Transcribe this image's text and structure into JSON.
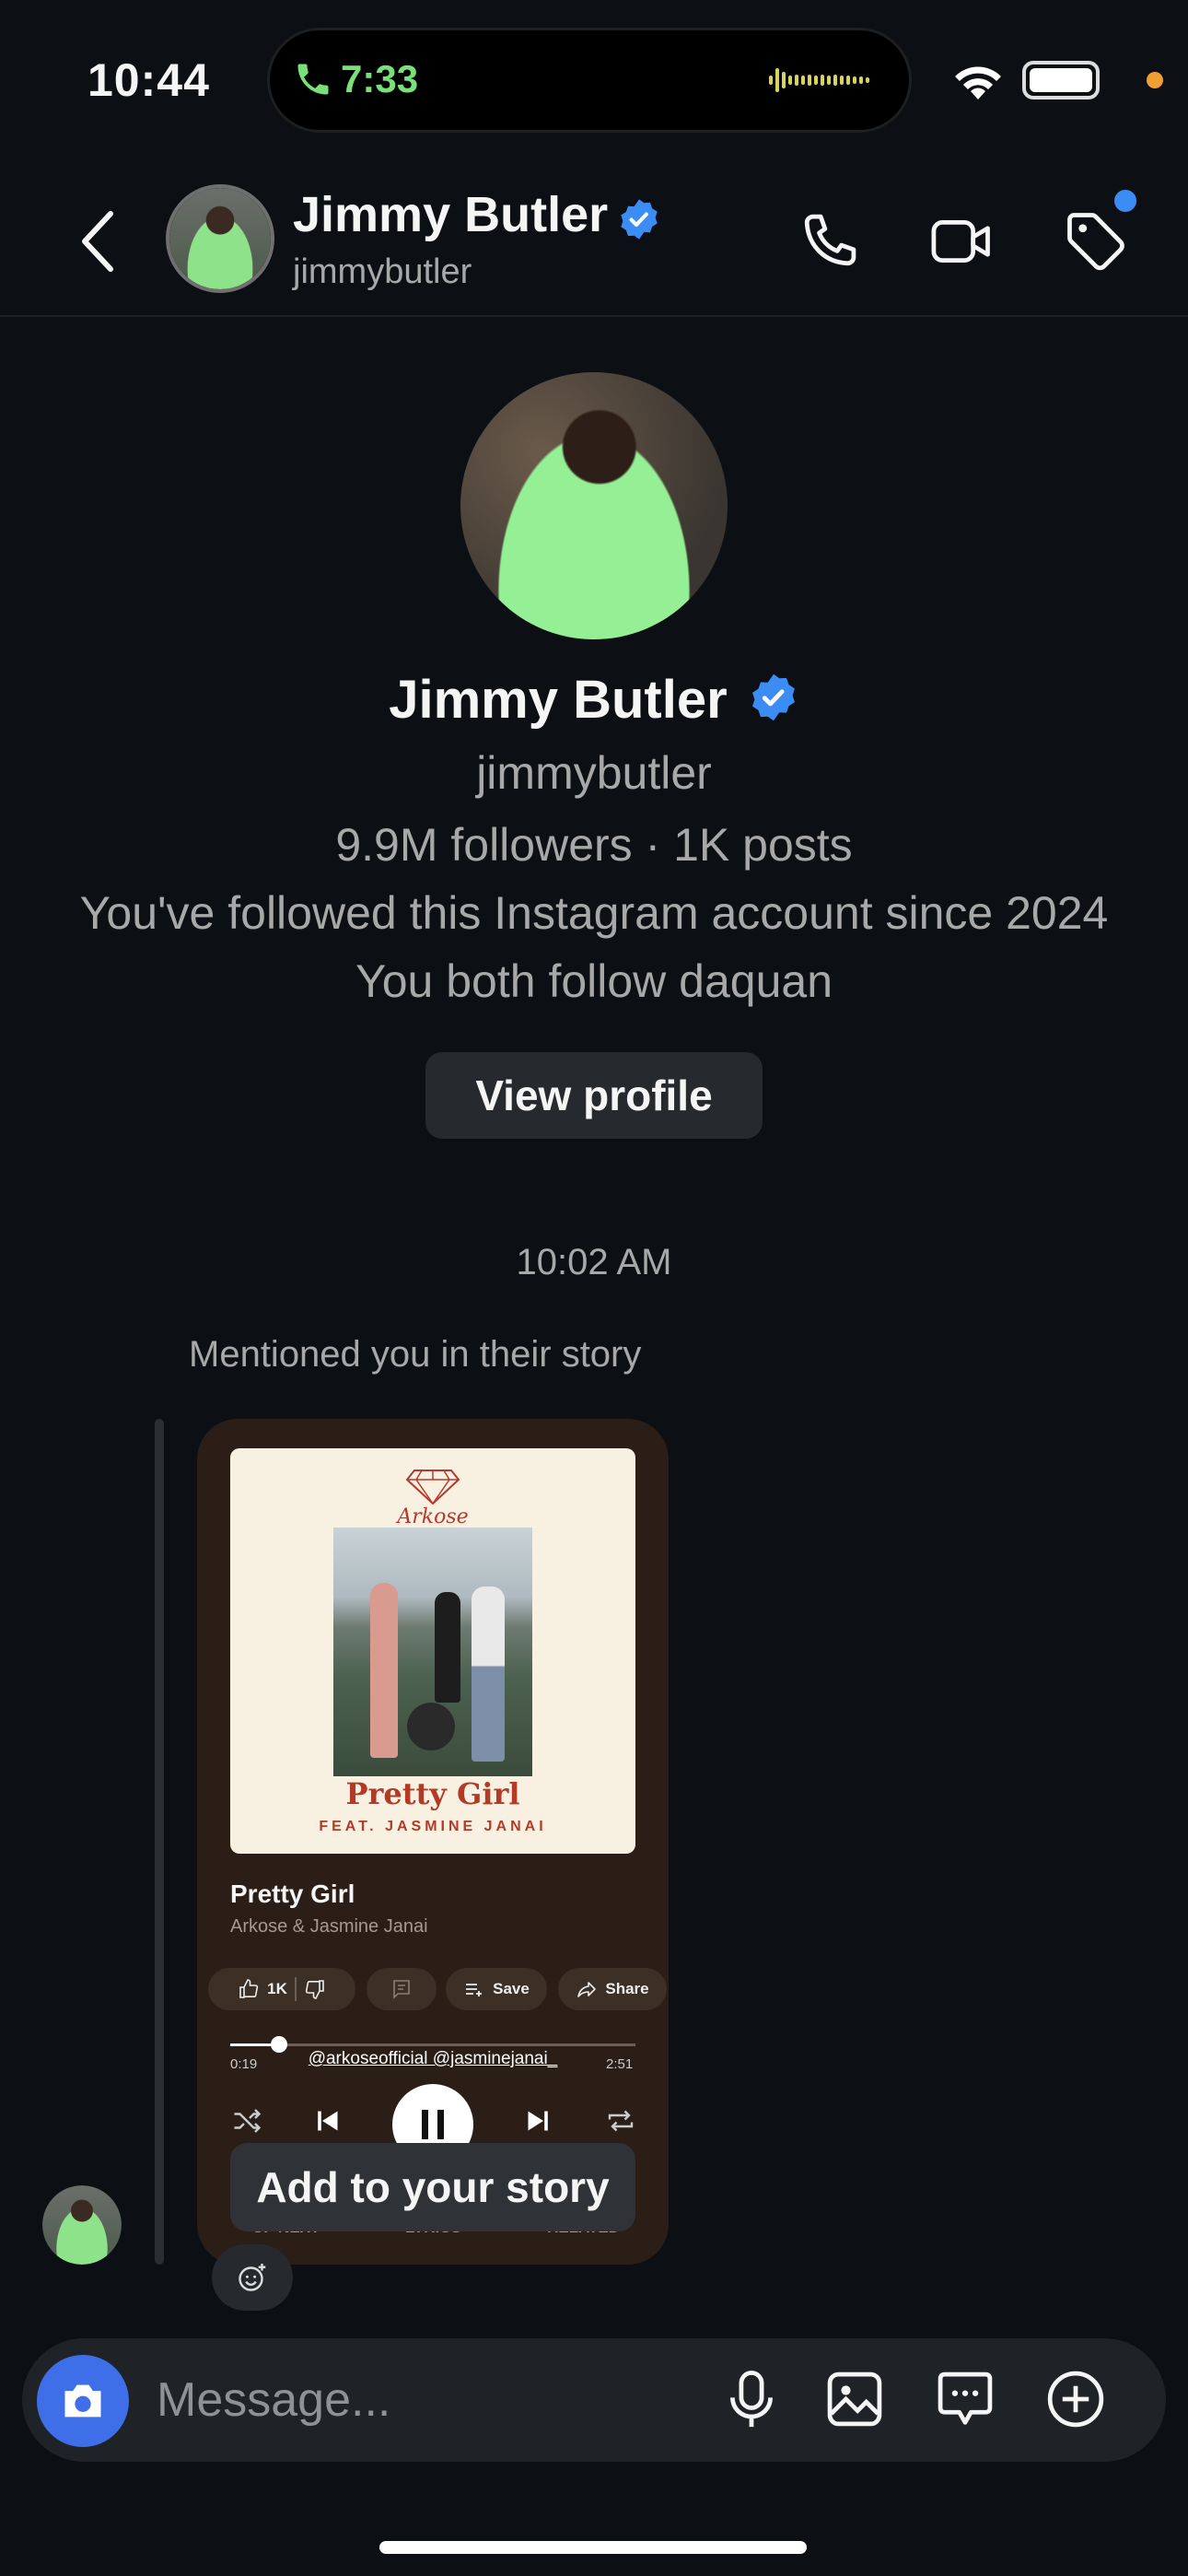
{
  "status_bar": {
    "time": "10:44",
    "call_time": "7:33"
  },
  "header": {
    "name": "Jimmy Butler",
    "username": "jimmybutler"
  },
  "profile": {
    "name": "Jimmy Butler",
    "username": "jimmybutler",
    "stats": "9.9M followers · 1K posts",
    "since": "You've followed this Instagram account since 2024",
    "mutual": "You both follow daquan",
    "view_profile_label": "View profile"
  },
  "chat": {
    "timestamp": "10:02 AM",
    "mention_text": "Mentioned you in their story",
    "story": {
      "art_brand": "Arkose",
      "art_title": "Pretty Girl",
      "art_feat": "FEAT. JASMINE JANAI",
      "song_title": "Pretty Girl",
      "artist": "Arkose & Jasmine Janai",
      "like_count": "1K",
      "save_label": "Save",
      "share_label": "Share",
      "time_start": "0:19",
      "time_end": "2:51",
      "mentions": "@arkoseofficial @jasminejanai_",
      "progress": 0.12,
      "tab_up_next": "UP NEXT",
      "tab_lyrics": "LYRICS",
      "tab_related": "RELATED"
    },
    "add_story_label": "Add to your story"
  },
  "composer": {
    "placeholder": "Message..."
  },
  "colors": {
    "background": "#0c1014",
    "accent": "#3e6ee8",
    "verified": "#3c8cf5",
    "secondary_text": "#a8a8a8"
  }
}
